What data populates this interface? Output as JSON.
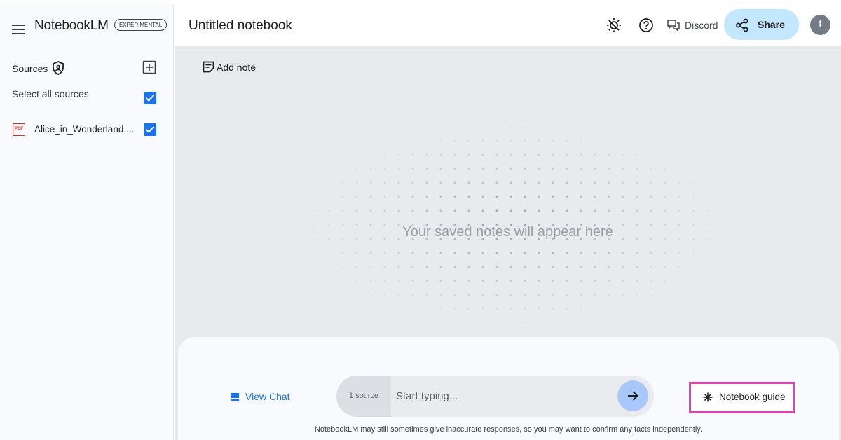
{
  "app": {
    "brand": "NotebookLM",
    "badge": "EXPERIMENTAL"
  },
  "sidebar": {
    "sources_label": "Sources",
    "select_all_label": "Select all sources",
    "select_all_checked": true,
    "sources": [
      {
        "name": "Alice_in_Wonderland....",
        "type": "PDF",
        "checked": true
      }
    ]
  },
  "header": {
    "notebook_title": "Untitled notebook",
    "discord_label": "Discord",
    "share_label": "Share",
    "avatar_initial": "t"
  },
  "notes": {
    "add_note_label": "Add note",
    "empty_message": "Your saved notes will appear here"
  },
  "chat": {
    "view_chat_label": "View Chat",
    "source_count": "1 source",
    "input_placeholder": "Start typing...",
    "notebook_guide_label": "Notebook guide",
    "disclaimer": "NotebookLM may still sometimes give inaccurate responses, so you may want to confirm any facts independently."
  },
  "colors": {
    "accent": "#1a73e8",
    "share_bg": "#c2e7ff",
    "send_bg": "#a8c7fa",
    "highlight_border": "#e340b8",
    "notes_bg": "#e8eaed"
  },
  "icons": [
    "menu-icon",
    "shield-icon",
    "add-source-icon",
    "pdf-icon",
    "checkbox-icon",
    "theme-icon",
    "help-icon",
    "discord-icon",
    "share-icon",
    "note-icon",
    "chat-icon",
    "arrow-right-icon",
    "sparkle-icon"
  ]
}
